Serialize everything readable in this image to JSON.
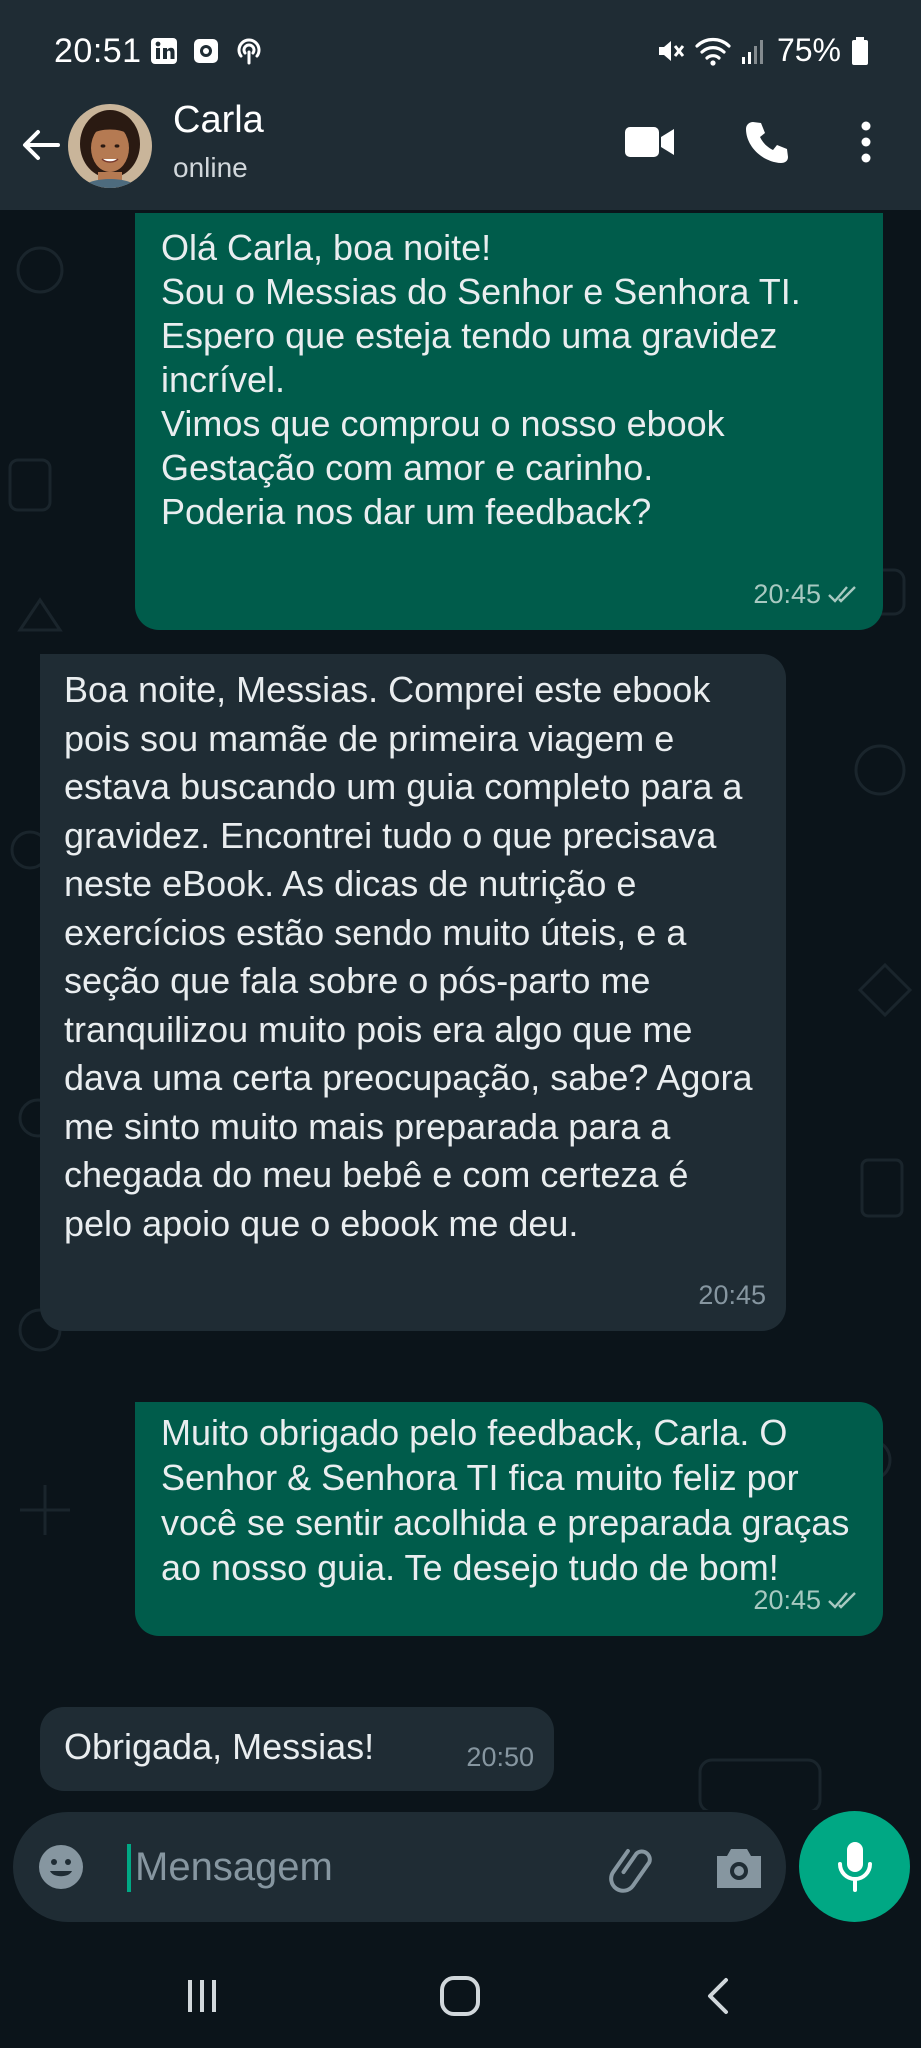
{
  "status_bar": {
    "time": "20:51",
    "battery": "75%",
    "icons": [
      "linkedin-icon",
      "notification-icon",
      "hotspot-icon",
      "mute-icon",
      "wifi-icon",
      "signal-icon",
      "battery-icon"
    ]
  },
  "header": {
    "contact_name": "Carla",
    "contact_status": "online",
    "actions": [
      "video-call-icon",
      "voice-call-icon",
      "more-options-icon"
    ]
  },
  "messages": [
    {
      "direction": "out",
      "text": "Olá Carla, boa noite!\nSou o Messias do Senhor e Senhora TI. Espero que esteja tendo uma gravidez incrível.\nVimos que comprou o nosso ebook Gestação com amor e carinho.\nPoderia nos dar um feedback?",
      "time": "20:45",
      "read": true
    },
    {
      "direction": "in",
      "text": "Boa noite, Messias. Comprei este ebook pois sou mamãe de primeira viagem e estava buscando um guia completo para a gravidez. Encontrei tudo o que precisava neste eBook. As dicas de nutrição e exercícios estão sendo muito úteis, e a seção que fala sobre o pós-parto me tranquilizou muito pois era algo que me dava uma certa preocupação, sabe? Agora me sinto muito mais preparada para a chegada do meu bebê e com certeza é pelo apoio que o ebook me deu.",
      "time": "20:45"
    },
    {
      "direction": "out",
      "text": "Muito obrigado pelo feedback, Carla. O Senhor & Senhora TI fica muito feliz por você se sentir acolhida e preparada graças ao nosso guia. Te desejo tudo de bom!",
      "time": "20:45",
      "read": true
    },
    {
      "direction": "in",
      "text": "Obrigada, Messias!",
      "time": "20:50"
    }
  ],
  "composer": {
    "placeholder": "Mensagem"
  },
  "colors": {
    "background": "#0b141a",
    "bar": "#1f2c34",
    "outgoing_bubble": "#005c4b",
    "incoming_bubble": "#1f2c34",
    "accent": "#00a884",
    "read_ticks": "#a8c9c1"
  },
  "nav": [
    "recent-apps-icon",
    "home-icon",
    "back-nav-icon"
  ]
}
